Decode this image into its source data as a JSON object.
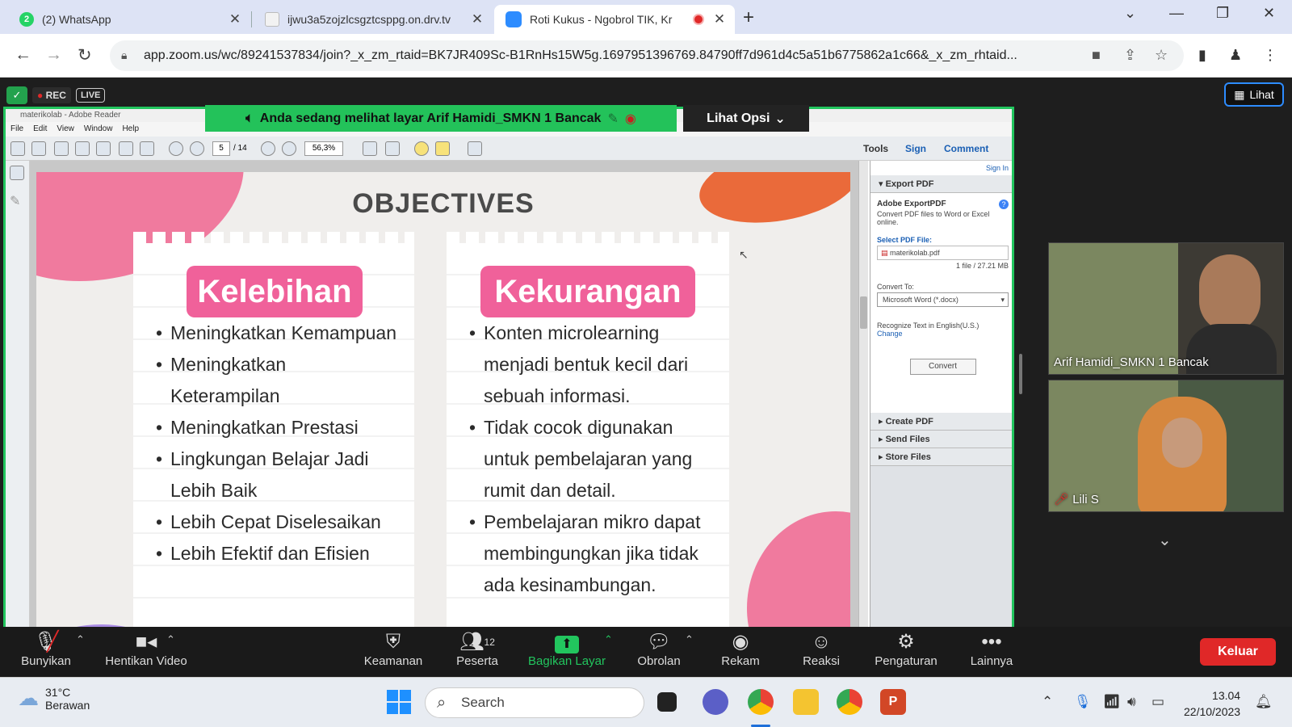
{
  "browser": {
    "tabs": [
      {
        "title": "(2) WhatsApp",
        "badge": "2"
      },
      {
        "title": "ijwu3a5zojzlcsgztcsppg.on.drv.tv"
      },
      {
        "title": "Roti Kukus - Ngobrol TIK, Kr"
      }
    ],
    "url": "app.zoom.us/wc/89241537834/join?_x_zm_rtaid=BK7JR409Sc-B1RnHs15W5g.1697951396769.84790ff7d961d4c5a51b6775862a1c66&_x_zm_rhtaid..."
  },
  "zoom": {
    "rec": "REC",
    "live": "LIVE",
    "view_btn": "Lihat",
    "share_banner": "Anda sedang melihat layar  Arif Hamidi_SMKN 1 Bancak",
    "options": "Lihat Opsi",
    "participants": [
      {
        "name": "Arif Hamidi_SMKN 1 Bancak"
      },
      {
        "name": "Lili S"
      }
    ],
    "toolbar": [
      {
        "label": "Bunyikan",
        "icon": "muted-mic-icon"
      },
      {
        "label": "Hentikan Video",
        "icon": "video-camera-icon"
      },
      {
        "label": "Keamanan",
        "icon": "shield-icon"
      },
      {
        "label": "Peserta",
        "icon": "participants-icon",
        "count": "12"
      },
      {
        "label": "Bagikan Layar",
        "icon": "share-screen-icon"
      },
      {
        "label": "Obrolan",
        "icon": "chat-icon"
      },
      {
        "label": "Rekam",
        "icon": "record-icon"
      },
      {
        "label": "Reaksi",
        "icon": "reaction-icon"
      },
      {
        "label": "Pengaturan",
        "icon": "settings-gear-icon"
      },
      {
        "label": "Lainnya",
        "icon": "more-icon"
      }
    ],
    "leave": "Keluar",
    "accent": "#22c55e"
  },
  "reader": {
    "window_title": "materikolab - Adobe Reader",
    "menu": [
      "File",
      "Edit",
      "View",
      "Window",
      "Help"
    ],
    "page": "5",
    "pages": "/ 14",
    "zoom": "56,3%",
    "links": [
      "Tools",
      "Sign",
      "Comment"
    ],
    "signin": "Sign In",
    "export": {
      "header": "Export PDF",
      "title": "Adobe ExportPDF",
      "desc": "Convert PDF files to Word or Excel online.",
      "select_label": "Select PDF File:",
      "file": "materikolab.pdf",
      "file_info": "1 file / 27.21 MB",
      "convert_to": "Convert To:",
      "format": "Microsoft Word (*.docx)",
      "recognize": "Recognize Text in English(U.S.)",
      "change": "Change",
      "convert_btn": "Convert"
    },
    "sections": [
      "Create PDF",
      "Send Files",
      "Store Files"
    ]
  },
  "slide": {
    "title": "OBJECTIVES",
    "left": {
      "heading": "Kelebihan",
      "items": [
        "Meningkatkan Kemampuan",
        "Meningkatkan Keterampilan",
        "Meningkatkan Prestasi",
        "Lingkungan Belajar Jadi Lebih Baik",
        "Lebih Cepat Diselesaikan",
        "Lebih Efektif dan Efisien"
      ]
    },
    "right": {
      "heading": "Kekurangan",
      "items": [
        "Konten microlearning menjadi bentuk kecil dari sebuah informasi.",
        "Tidak cocok digunakan untuk pembelajaran yang rumit dan detail.",
        "Pembelajaran mikro dapat membingungkan jika tidak ada kesinambungan."
      ]
    }
  },
  "taskbar": {
    "temp": "31°C",
    "weather": "Berawan",
    "search": "Search",
    "time": "13.04",
    "date": "22/10/2023"
  }
}
